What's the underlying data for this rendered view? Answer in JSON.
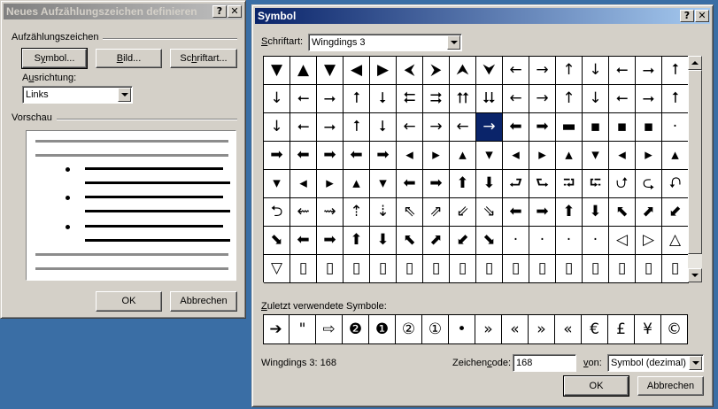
{
  "bullet_dialog": {
    "title": "Neues Aufzählungszeichen definieren",
    "help_btn": "?",
    "close_btn": "✕",
    "group_label": "Aufzählungszeichen",
    "symbol_btn_pre": "S",
    "symbol_btn_u": "y",
    "symbol_btn_post": "mbol...",
    "picture_btn_pre": "",
    "picture_btn_u": "B",
    "picture_btn_post": "ild...",
    "font_btn_pre": "Sc",
    "font_btn_u": "h",
    "font_btn_post": "riftart...",
    "alignment_label_pre": "A",
    "alignment_label_u": "u",
    "alignment_label_post": "srichtung:",
    "alignment_value": "Links",
    "preview_label": "Vorschau",
    "ok": "OK",
    "cancel": "Abbrechen"
  },
  "symbol_dialog": {
    "title": "Symbol",
    "help_btn": "?",
    "close_btn": "✕",
    "font_label_pre": "",
    "font_label_u": "S",
    "font_label_post": "chriftart:",
    "font_value": "Wingdings 3",
    "recent_label_pre": "",
    "recent_label_u": "Z",
    "recent_label_post": "uletzt verwendete Symbole:",
    "status_text": "Wingdings 3: 168",
    "charcode_label_pre": "Zeichen",
    "charcode_label_u": "c",
    "charcode_label_post": "ode:",
    "charcode_value": "168",
    "from_label_pre": "",
    "from_label_u": "v",
    "from_label_post": "on:",
    "from_value": "Symbol (dezimal)",
    "ok": "OK",
    "cancel": "Abbrechen",
    "selected_index": 40
  },
  "symbols": [
    "▼",
    "▲",
    "▼",
    "◀",
    "▶",
    "⮜",
    "⮞",
    "⮝",
    "⮟",
    "←",
    "→",
    "↑",
    "↓",
    "⭠",
    "⭢",
    "⭡",
    "↓",
    "⭠",
    "⭢",
    "⭡",
    "⭣",
    "⮄",
    "⮆",
    "⮅",
    "⮇",
    "←",
    "→",
    "↑",
    "↓",
    "⭠",
    "⭢",
    "⭡",
    "↓",
    "⭠",
    "⭢",
    "⭡",
    "⭣",
    "←",
    "→",
    "←",
    "→",
    "⬅",
    "➡",
    "▬",
    "▪",
    "▪",
    "▪",
    "·",
    "➡",
    "⬅",
    "➡",
    "⬅",
    "➡",
    "◂",
    "▸",
    "▴",
    "▾",
    "◂",
    "▸",
    "▴",
    "▾",
    "◂",
    "▸",
    "▴",
    "▾",
    "◂",
    "▸",
    "▴",
    "▾",
    "⬅",
    "➡",
    "⬆",
    "⬇",
    "⮐",
    "⮑",
    "⮒",
    "⮓",
    "⮍",
    "⮎",
    "⮏",
    "⮌",
    "⇜",
    "⇝",
    "⇡",
    "⇣",
    "⇖",
    "⇗",
    "⇙",
    "⇘",
    "⬅",
    "➡",
    "⬆",
    "⬇",
    "⬉",
    "⬈",
    "⬋",
    "⬊",
    "⬅",
    "➡",
    "⬆",
    "⬇",
    "⬉",
    "⬈",
    "⬋",
    "⬊",
    "·",
    "·",
    "·",
    "·",
    "◁",
    "▷",
    "△",
    "▽",
    "▯",
    "▯",
    "▯",
    "▯",
    "▯",
    "▯",
    "▯",
    "▯",
    "▯",
    "▯",
    "▯",
    "▯",
    "▯",
    "▯",
    "▯"
  ],
  "recent_symbols": [
    "➔",
    "\"",
    "⇨",
    "❷",
    "❶",
    "②",
    "①",
    "•",
    "»",
    "«",
    "»",
    "«",
    "€",
    "£",
    "¥",
    "©"
  ]
}
